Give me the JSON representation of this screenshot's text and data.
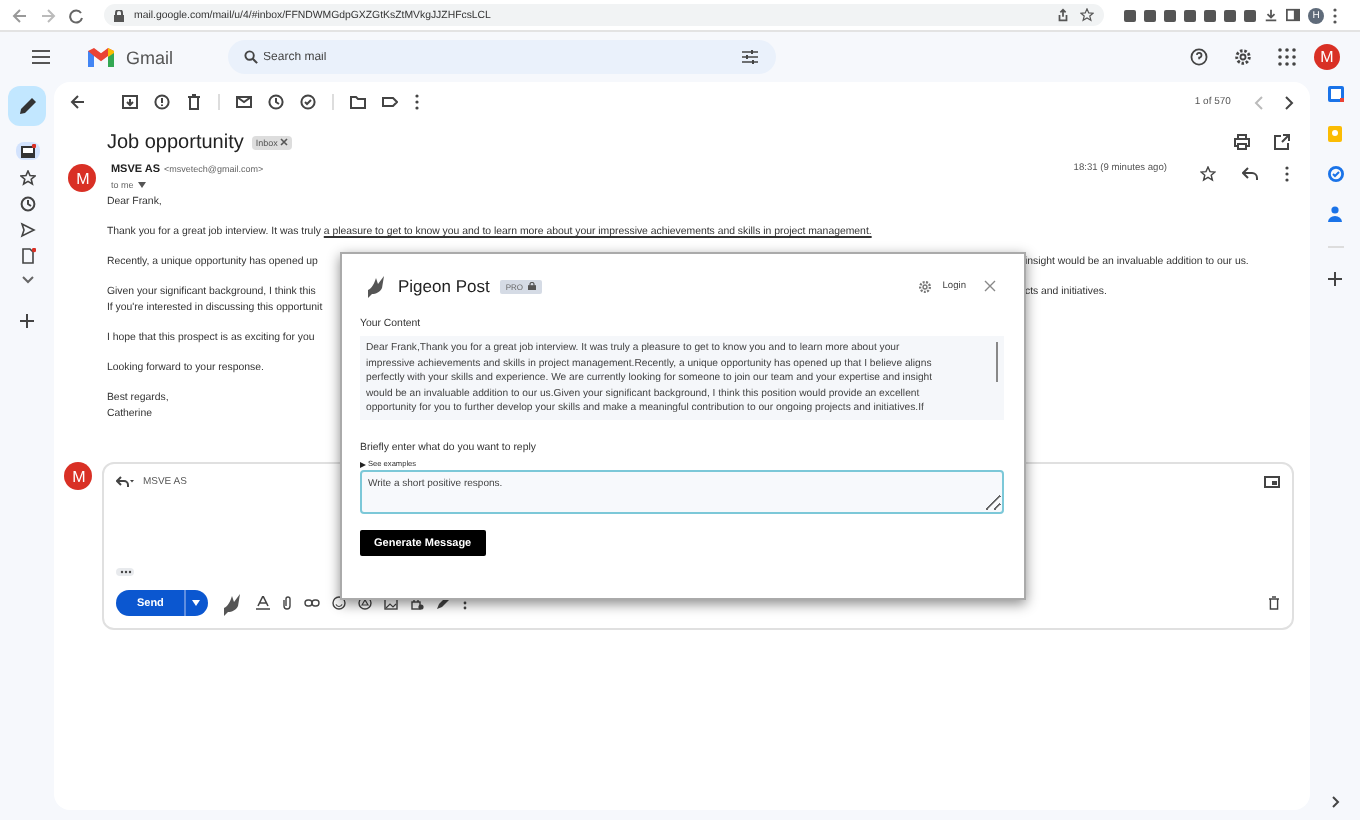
{
  "browser": {
    "url": "mail.google.com/mail/u/4/#inbox/FFNDWMGdpGXZGtKsZtMVkgJJZHFcsLCL",
    "profile": "H"
  },
  "header": {
    "app_name": "Gmail",
    "search": {
      "placeholder": "Search mail"
    },
    "avatar": "M"
  },
  "rail": [
    {
      "selected": true,
      "dot": true
    },
    {
      "selected": false,
      "dot": false
    },
    {
      "selected": false,
      "dot": false
    },
    {
      "selected": false,
      "dot": false
    },
    {
      "selected": false,
      "dot": true
    }
  ],
  "toolbar": {
    "pager": "1 of 570"
  },
  "message": {
    "subject": "Job opportunity",
    "label": "Inbox",
    "avatar": "M",
    "sender": "MSVE AS",
    "email": "<msvetech@gmail.com>",
    "to": "to me",
    "time": "18:31 (9 minutes ago)",
    "starred": false,
    "paragraphs": [
      {
        "lines": [
          {
            "text": "Dear Frank,"
          }
        ]
      },
      {
        "lines": [
          {
            "text": "Thank you for a great job interview. It was truly ",
            "underlined": "a pleasure to get to know you and to learn more about your impressive achievements and skills in project management."
          }
        ]
      },
      {
        "lines": [
          {
            "text": "Recently, a unique opportunity has opened up",
            "tail": "insight would be an invaluable addition to our us."
          }
        ]
      },
      {
        "lines": [
          {
            "text": "Given your significant background, I think this",
            "tail": "cts and initiatives."
          },
          {
            "text": "If you're interested in discussing this opportunit"
          }
        ]
      },
      {
        "lines": [
          {
            "text": "I hope that this prospect is as exciting for you"
          }
        ]
      },
      {
        "lines": [
          {
            "text": "Looking forward to your response."
          }
        ]
      },
      {
        "lines": [
          {
            "text": "Best regards,"
          },
          {
            "text": "Catherine"
          }
        ]
      }
    ]
  },
  "reply": {
    "avatar": "M",
    "to": "MSVE AS",
    "send": "Send"
  },
  "pigeon": {
    "title": "Pigeon Post",
    "badge": "PRO",
    "login": "Login",
    "content_label": "Your Content",
    "content_lines": [
      "Dear Frank,Thank you for a great job interview. It was truly a pleasure to get to know you and to learn more about your",
      "impressive achievements and skills in project management.Recently, a unique opportunity has opened up that I believe aligns",
      "perfectly with your skills and experience. We are currently looking for someone to join our team and your expertise and insight",
      "would be an invaluable addition to our us.Given your significant background, I think this position would provide an excellent",
      "opportunity for you to further develop your skills and make a meaningful contribution to our ongoing projects and initiatives.If"
    ],
    "prompt_label": "Briefly enter what do you want to reply",
    "examples": "See examples",
    "examples_expanded": false,
    "prompt_value": "Write a short positive respons.",
    "generate": "Generate Message"
  }
}
